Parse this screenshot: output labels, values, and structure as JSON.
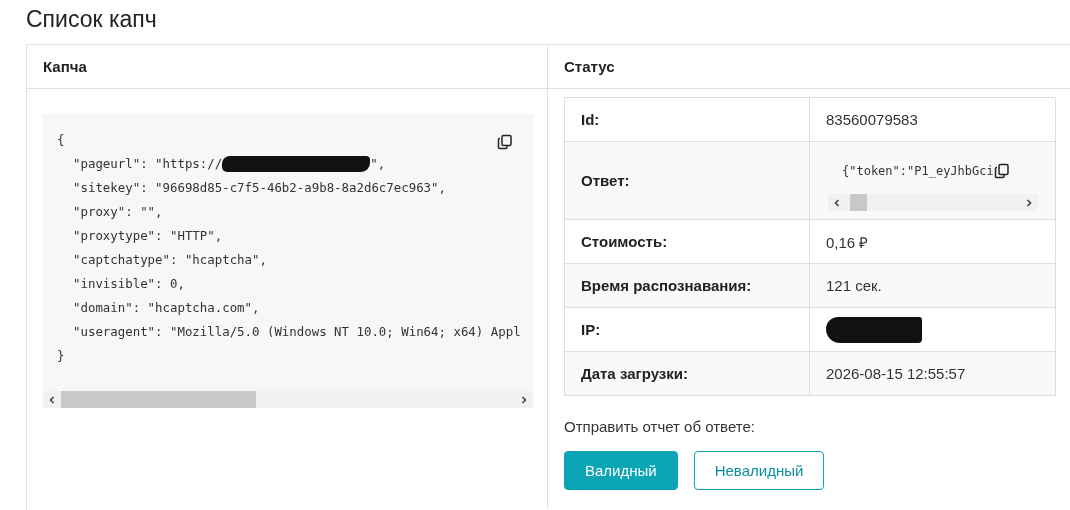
{
  "page_title": "Список капч",
  "columns": [
    "Капча",
    "Статус"
  ],
  "captcha_code": {
    "lines": [
      {
        "text": "{",
        "indent": false
      },
      {
        "text": "\"pageurl\": \"https://",
        "indent": true,
        "redacted": true,
        "after": "\","
      },
      {
        "text": "\"sitekey\": \"96698d85-c7f5-46b2-a9b8-8a2d6c7ec963\",",
        "indent": true
      },
      {
        "text": "\"proxy\": \"\",",
        "indent": true
      },
      {
        "text": "\"proxytype\": \"HTTP\",",
        "indent": true
      },
      {
        "text": "\"captchatype\": \"hcaptcha\",",
        "indent": true
      },
      {
        "text": "\"invisible\": 0,",
        "indent": true
      },
      {
        "text": "\"domain\": \"hcaptcha.com\",",
        "indent": true
      },
      {
        "text": "\"useragent\": \"Mozilla/5.0 (Windows NT 10.0; Win64; x64) Appl",
        "indent": true
      },
      {
        "text": "}",
        "indent": false
      }
    ]
  },
  "status_rows": [
    {
      "label": "Id:",
      "kind": "text",
      "value": "83560079583"
    },
    {
      "label": "Ответ:",
      "kind": "code",
      "value": "{\"token\":\"P1_eyJhbGci"
    },
    {
      "label": "Стоимость:",
      "kind": "text",
      "value": "0,16 ₽"
    },
    {
      "label": "Время распознавания:",
      "kind": "text",
      "value": "121 сек."
    },
    {
      "label": "IP:",
      "kind": "redacted"
    },
    {
      "label": "Дата загрузки:",
      "kind": "text",
      "value": "2026-08-15 12:55:57"
    }
  ],
  "report": {
    "label": "Отправить отчет об ответе:",
    "buttons": [
      {
        "label": "Валидный",
        "kind": "primary"
      },
      {
        "label": "Невалидный",
        "kind": "outline"
      }
    ]
  }
}
